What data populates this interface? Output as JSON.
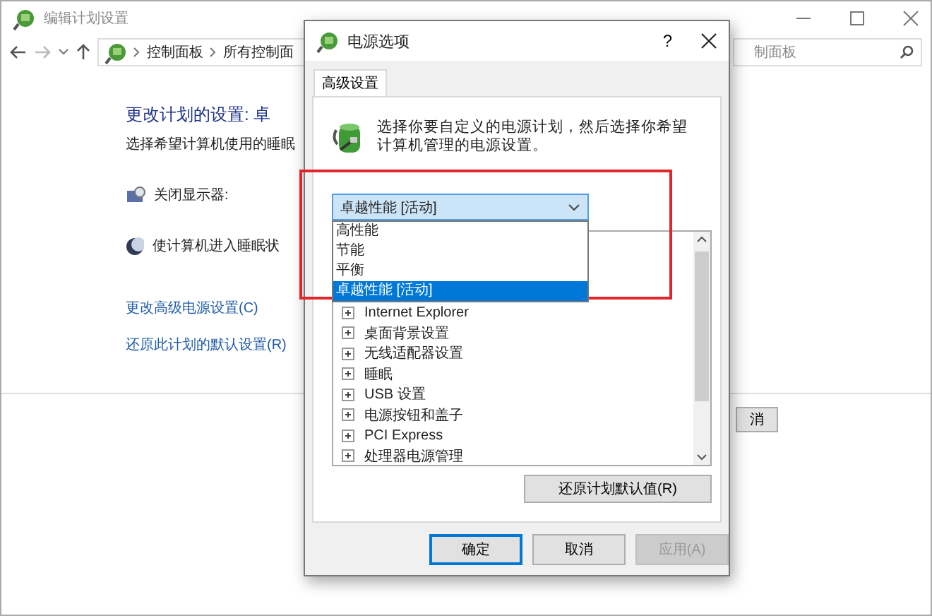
{
  "window": {
    "title": "编辑计划设置"
  },
  "address_bar": {
    "crumbs": [
      "控制面板",
      "所有控制面"
    ]
  },
  "search": {
    "placeholder": "制面板"
  },
  "plan": {
    "heading": "更改计划的设置: 卓",
    "subtitle": "选择希望计算机使用的睡眠",
    "settings": [
      {
        "kind": "display",
        "label": "关闭显示器:"
      },
      {
        "kind": "sleep",
        "label": "使计算机进入睡眠状"
      }
    ],
    "links": [
      "更改高级电源设置(C)",
      "还原此计划的默认设置(R)"
    ]
  },
  "footer_button": "消",
  "dialog": {
    "title": "电源选项",
    "help": "?",
    "tabs": [
      {
        "label": "高级设置",
        "selected": true
      }
    ],
    "description": "选择你要自定义的电源计划，然后选择你希望计算机管理的电源设置。",
    "plan_select": {
      "value": "卓越性能 [活动]",
      "expanded": true,
      "options": [
        {
          "label": "高性能",
          "selected": false
        },
        {
          "label": "节能",
          "selected": false
        },
        {
          "label": "平衡",
          "selected": false
        },
        {
          "label": "卓越性能 [活动]",
          "selected": true
        }
      ]
    },
    "settings_tree": [
      {
        "label": "Internet Explorer",
        "expanded": false
      },
      {
        "label": "桌面背景设置",
        "expanded": false
      },
      {
        "label": "无线适配器设置",
        "expanded": false
      },
      {
        "label": "睡眠",
        "expanded": false
      },
      {
        "label": "USB 设置",
        "expanded": false
      },
      {
        "label": "电源按钮和盖子",
        "expanded": false
      },
      {
        "label": "PCI Express",
        "expanded": false
      },
      {
        "label": "处理器电源管理",
        "expanded": false
      }
    ],
    "restore_button": "还原计划默认值(R)",
    "buttons": [
      {
        "label": "确定",
        "focused": true,
        "disabled": false
      },
      {
        "label": "取消",
        "focused": false,
        "disabled": false
      },
      {
        "label": "应用(A)",
        "focused": false,
        "disabled": true
      }
    ]
  }
}
